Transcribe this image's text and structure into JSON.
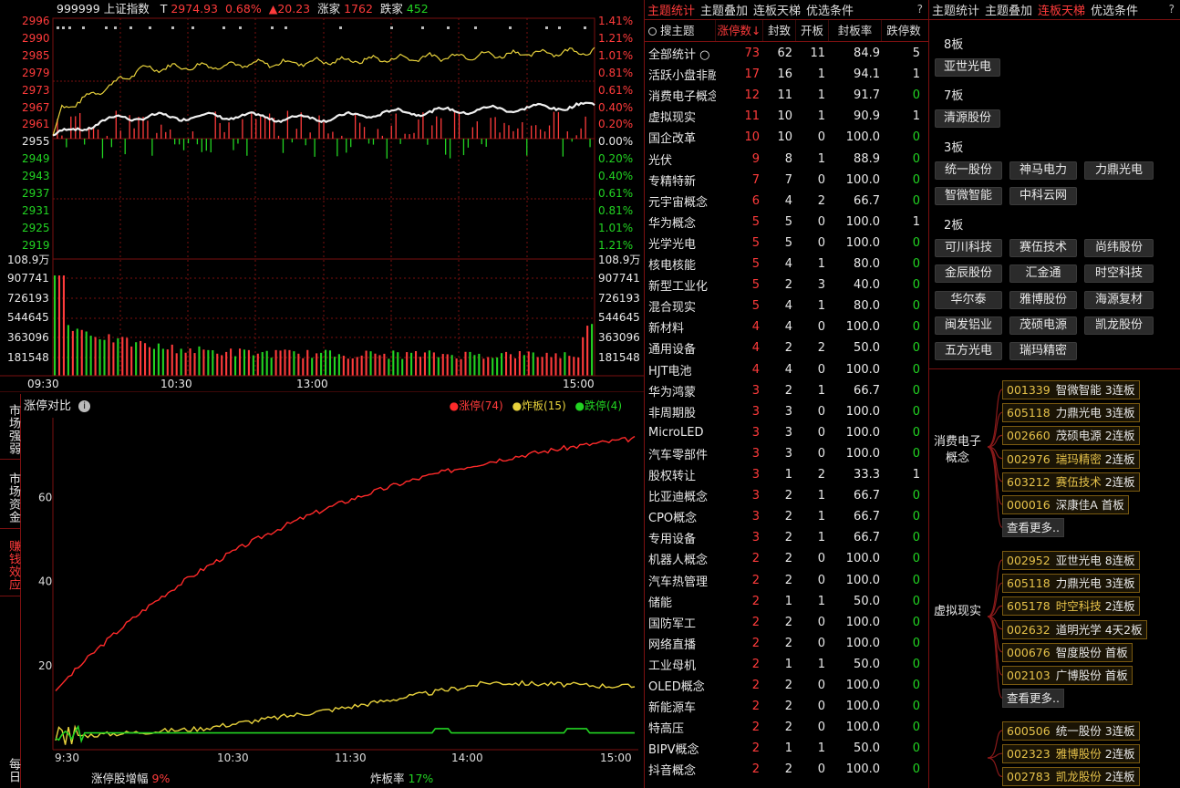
{
  "index_header": {
    "code_name": "999999 上证指数",
    "t_label": "T",
    "price": "2974.93",
    "pct": "0.68%",
    "change": "▲20.23",
    "up_label": "涨家",
    "up_count": "1762",
    "down_label": "跌家",
    "down_count": "452"
  },
  "price_axis_left": [
    "2996",
    "2990",
    "2985",
    "2979",
    "2973",
    "2967",
    "2961",
    "2955",
    "2949",
    "2943",
    "2937",
    "2931",
    "2925",
    "2919"
  ],
  "pct_axis_right": [
    "1.41%",
    "1.21%",
    "1.01%",
    "0.81%",
    "0.61%",
    "0.40%",
    "0.20%",
    "0.00%",
    "0.20%",
    "0.40%",
    "0.61%",
    "0.81%",
    "1.01%",
    "1.21%"
  ],
  "volume_axis": [
    "108.9万",
    "907741",
    "726193",
    "544645",
    "363096",
    "181548"
  ],
  "time_axis_top": [
    "09:30",
    "10:30",
    "13:00",
    "15:00"
  ],
  "bottom_chart": {
    "title": "涨停对比",
    "legend": [
      {
        "label": "涨停(74)",
        "color": "#ff2a2a"
      },
      {
        "label": "炸板(15)",
        "color": "#e8d23c"
      },
      {
        "label": "跌停(4)",
        "color": "#22d422"
      }
    ],
    "y_ticks": [
      "60",
      "40",
      "20"
    ],
    "x_ticks": [
      "9:30",
      "10:30",
      "11:30",
      "14:00",
      "15:00"
    ],
    "footer_left_label": "涨停股增幅",
    "footer_left_value": "9%",
    "footer_right_label": "炸板率",
    "footer_right_value": "17%"
  },
  "side_tabs": [
    {
      "label": "市场强弱"
    },
    {
      "label": "市场资金"
    },
    {
      "label": "赚钱效应"
    },
    {
      "label": "每日"
    }
  ],
  "chart_data": {
    "type": "line",
    "title": "涨停对比",
    "x": [
      "9:30",
      "10:30",
      "11:30",
      "14:00",
      "15:00"
    ],
    "ylim": [
      0,
      75
    ],
    "series": [
      {
        "name": "涨停(74)",
        "values": [
          14,
          45,
          57,
          68,
          74
        ]
      },
      {
        "name": "炸板(15)",
        "values": [
          3,
          5,
          10,
          16,
          15
        ]
      },
      {
        "name": "跌停(4)",
        "values": [
          5,
          4,
          4,
          4,
          4
        ]
      }
    ]
  },
  "mid_tabs": [
    "主题统计",
    "主题叠加",
    "连板天梯",
    "优选条件"
  ],
  "mid_help": "?",
  "mid_header": {
    "search": "搜主题",
    "cols": [
      "涨停数↓",
      "封致",
      "开板",
      "封板率",
      "跌停数"
    ]
  },
  "themes": [
    [
      "全部统计 ○",
      "73",
      "62",
      "11",
      "84.9",
      "5"
    ],
    [
      "活跃小盘非融",
      "17",
      "16",
      "1",
      "94.1",
      "1"
    ],
    [
      "消费电子概念",
      "12",
      "11",
      "1",
      "91.7",
      "0"
    ],
    [
      "虚拟现实",
      "11",
      "10",
      "1",
      "90.9",
      "1"
    ],
    [
      "国企改革",
      "10",
      "10",
      "0",
      "100.0",
      "0"
    ],
    [
      "光伏",
      "9",
      "8",
      "1",
      "88.9",
      "0"
    ],
    [
      "专精特新",
      "7",
      "7",
      "0",
      "100.0",
      "0"
    ],
    [
      "元宇宙概念",
      "6",
      "4",
      "2",
      "66.7",
      "0"
    ],
    [
      "华为概念",
      "5",
      "5",
      "0",
      "100.0",
      "1"
    ],
    [
      "光学光电",
      "5",
      "5",
      "0",
      "100.0",
      "0"
    ],
    [
      "核电核能",
      "5",
      "4",
      "1",
      "80.0",
      "0"
    ],
    [
      "新型工业化",
      "5",
      "2",
      "3",
      "40.0",
      "0"
    ],
    [
      "混合现实",
      "5",
      "4",
      "1",
      "80.0",
      "0"
    ],
    [
      "新材料",
      "4",
      "4",
      "0",
      "100.0",
      "0"
    ],
    [
      "通用设备",
      "4",
      "2",
      "2",
      "50.0",
      "0"
    ],
    [
      "HJT电池",
      "4",
      "4",
      "0",
      "100.0",
      "0"
    ],
    [
      "华为鸿蒙",
      "3",
      "2",
      "1",
      "66.7",
      "0"
    ],
    [
      "非周期股",
      "3",
      "3",
      "0",
      "100.0",
      "0"
    ],
    [
      "MicroLED",
      "3",
      "3",
      "0",
      "100.0",
      "0"
    ],
    [
      "汽车零部件",
      "3",
      "3",
      "0",
      "100.0",
      "0"
    ],
    [
      "股权转让",
      "3",
      "1",
      "2",
      "33.3",
      "1"
    ],
    [
      "比亚迪概念",
      "3",
      "2",
      "1",
      "66.7",
      "0"
    ],
    [
      "CPO概念",
      "3",
      "2",
      "1",
      "66.7",
      "0"
    ],
    [
      "专用设备",
      "3",
      "2",
      "1",
      "66.7",
      "0"
    ],
    [
      "机器人概念",
      "2",
      "2",
      "0",
      "100.0",
      "0"
    ],
    [
      "汽车热管理",
      "2",
      "2",
      "0",
      "100.0",
      "0"
    ],
    [
      "储能",
      "2",
      "1",
      "1",
      "50.0",
      "0"
    ],
    [
      "国防军工",
      "2",
      "2",
      "0",
      "100.0",
      "0"
    ],
    [
      "网络直播",
      "2",
      "2",
      "0",
      "100.0",
      "0"
    ],
    [
      "工业母机",
      "2",
      "1",
      "1",
      "50.0",
      "0"
    ],
    [
      "OLED概念",
      "2",
      "2",
      "0",
      "100.0",
      "0"
    ],
    [
      "新能源车",
      "2",
      "2",
      "0",
      "100.0",
      "0"
    ],
    [
      "特高压",
      "2",
      "2",
      "0",
      "100.0",
      "0"
    ],
    [
      "BIPV概念",
      "2",
      "1",
      "1",
      "50.0",
      "0"
    ],
    [
      "抖音概念",
      "2",
      "2",
      "0",
      "100.0",
      "0"
    ]
  ],
  "right_tabs": [
    "主题统计",
    "主题叠加",
    "连板天梯",
    "优选条件"
  ],
  "right_help": "?",
  "ladder": [
    {
      "level": "8板",
      "stocks": [
        "亚世光电"
      ]
    },
    {
      "level": "7板",
      "stocks": [
        "清源股份"
      ]
    },
    {
      "level": "3板",
      "stocks": [
        "统一股份",
        "神马电力",
        "力鼎光电",
        "智微智能",
        "中科云网"
      ]
    },
    {
      "level": "2板",
      "stocks": [
        "可川科技",
        "赛伍技术",
        "尚纬股份",
        "金辰股份",
        "汇金通",
        "时空科技",
        "华尔泰",
        "雅博股份",
        "海源复材",
        "闽发铝业",
        "茂硕电源",
        "凯龙股份",
        "五方光电",
        "瑞玛精密"
      ]
    }
  ],
  "tree_groups": [
    {
      "name": "消费电子概念",
      "items": [
        {
          "code": "001339",
          "name": "智微智能",
          "board": "3连板",
          "hl": false
        },
        {
          "code": "605118",
          "name": "力鼎光电",
          "board": "3连板",
          "hl": false
        },
        {
          "code": "002660",
          "name": "茂硕电源",
          "board": "2连板",
          "hl": false
        },
        {
          "code": "002976",
          "name": "瑞玛精密",
          "board": "2连板",
          "hl": true
        },
        {
          "code": "603212",
          "name": "赛伍技术",
          "board": "2连板",
          "hl": true
        },
        {
          "code": "000016",
          "name": "深康佳A",
          "board": "首板",
          "hl": false
        }
      ],
      "more": "查看更多.."
    },
    {
      "name": "虚拟现实",
      "items": [
        {
          "code": "002952",
          "name": "亚世光电",
          "board": "8连板",
          "hl": false
        },
        {
          "code": "605118",
          "name": "力鼎光电",
          "board": "3连板",
          "hl": false
        },
        {
          "code": "605178",
          "name": "时空科技",
          "board": "2连板",
          "hl": true
        },
        {
          "code": "002632",
          "name": "道明光学",
          "board": "4天2板",
          "hl": false
        },
        {
          "code": "000676",
          "name": "智度股份",
          "board": "首板",
          "hl": false
        },
        {
          "code": "002103",
          "name": "广博股份",
          "board": "首板",
          "hl": false
        }
      ],
      "more": "查看更多.."
    },
    {
      "name": "",
      "items": [
        {
          "code": "600506",
          "name": "统一股份",
          "board": "3连板",
          "hl": false
        },
        {
          "code": "002323",
          "name": "雅博股份",
          "board": "2连板",
          "hl": true
        },
        {
          "code": "002783",
          "name": "凯龙股份",
          "board": "2连板",
          "hl": true
        }
      ],
      "more": ""
    }
  ]
}
